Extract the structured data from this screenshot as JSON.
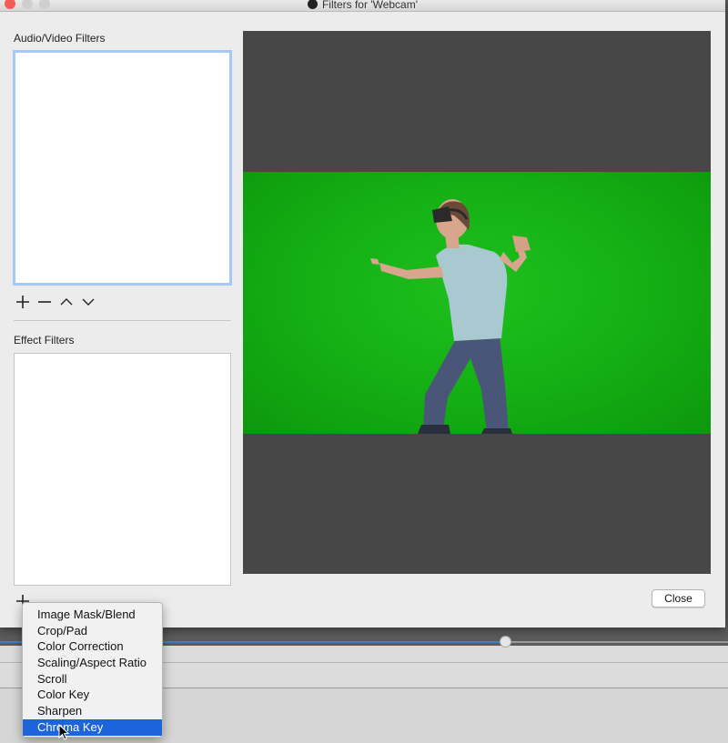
{
  "window": {
    "title": "Filters for 'Webcam'",
    "traffic_lights": [
      "close-icon",
      "minimize-icon",
      "maximize-icon"
    ]
  },
  "audio_video": {
    "label": "Audio/Video Filters",
    "items": [],
    "controls": [
      "add-icon",
      "remove-icon",
      "move-up-icon",
      "move-down-icon"
    ]
  },
  "effect": {
    "label": "Effect Filters",
    "items": []
  },
  "preview": {
    "background_color": "#474747",
    "screen_color": "#14b014",
    "content": "person-wearing-vr-headset-on-green-screen"
  },
  "close_button": {
    "label": "Close"
  },
  "menu": {
    "items": [
      "Image Mask/Blend",
      "Crop/Pad",
      "Color Correction",
      "Scaling/Aspect Ratio",
      "Scroll",
      "Color Key",
      "Sharpen",
      "Chroma Key"
    ],
    "selected": "Chroma Key",
    "highlight_color": "#1b64d9"
  }
}
